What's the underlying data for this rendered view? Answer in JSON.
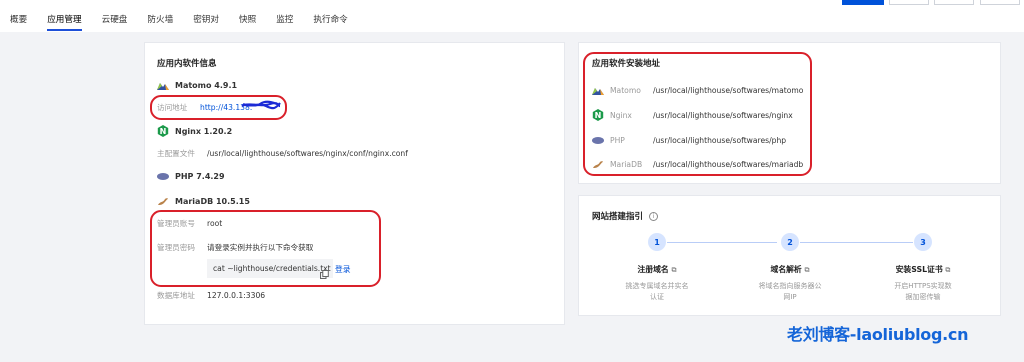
{
  "tabs": [
    "概要",
    "应用管理",
    "云硬盘",
    "防火墙",
    "密钥对",
    "快照",
    "监控",
    "执行命令"
  ],
  "left_card": {
    "title": "应用内软件信息",
    "matomo": {
      "name": "Matomo 4.9.1",
      "access_label": "访问地址",
      "access_value": "http://43.138."
    },
    "nginx": {
      "name": "Nginx 1.20.2",
      "config_label": "主配置文件",
      "config_value": "/usr/local/lighthouse/softwares/nginx/conf/nginx.conf"
    },
    "php": {
      "name": "PHP 7.4.29"
    },
    "mariadb": {
      "name": "MariaDB 10.5.15",
      "admin_user_label": "管理员账号",
      "admin_user_value": "root",
      "admin_pass_label": "管理员密码",
      "admin_pass_value": "请登录实例并执行以下命令获取",
      "command": "cat ~lighthouse/credentials.txt",
      "login": "登录",
      "db_addr_label": "数据库地址",
      "db_addr_value": "127.0.0.1:3306"
    }
  },
  "right_card": {
    "title": "应用软件安装地址",
    "items": [
      {
        "name": "Matomo",
        "path": "/usr/local/lighthouse/softwares/matomo"
      },
      {
        "name": "Nginx",
        "path": "/usr/local/lighthouse/softwares/nginx"
      },
      {
        "name": "PHP",
        "path": "/usr/local/lighthouse/softwares/php"
      },
      {
        "name": "MariaDB",
        "path": "/usr/local/lighthouse/softwares/mariadb"
      }
    ]
  },
  "guide": {
    "title": "网站搭建指引",
    "steps": [
      {
        "num": "1",
        "title": "注册域名",
        "desc1": "挑选专属域名并实名",
        "desc2": "认证"
      },
      {
        "num": "2",
        "title": "域名解析",
        "desc1": "将域名指向服务器公",
        "desc2": "网IP"
      },
      {
        "num": "3",
        "title": "安装SSL证书",
        "desc1": "开启HTTPS实现数",
        "desc2": "据加密传输"
      }
    ]
  },
  "watermark": "老刘博客-laoliublog.cn",
  "colors": {
    "accent": "#0052d9",
    "highlight": "#d9202a"
  }
}
